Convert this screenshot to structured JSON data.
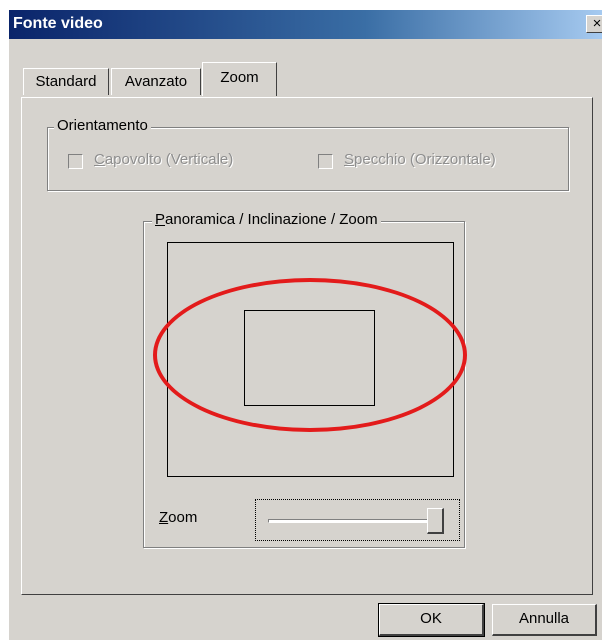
{
  "window": {
    "title": "Fonte video",
    "close_label": "×"
  },
  "tabs": [
    {
      "label": "Standard",
      "active": false
    },
    {
      "label": "Avanzato",
      "active": false
    },
    {
      "label": "Zoom",
      "active": true
    }
  ],
  "orientation": {
    "group_label": "Orientamento",
    "flip_vertical": {
      "label": "Capovolto (Verticale)",
      "checked": false,
      "enabled": false
    },
    "mirror_horizontal": {
      "label": "Specchio (Orizzontale)",
      "checked": false,
      "enabled": false
    }
  },
  "ptz": {
    "group_label": "Panoramica / Inclinazione / Zoom",
    "zoom_label": "Zoom",
    "zoom_level": 1.0
  },
  "buttons": {
    "ok": "OK",
    "cancel": "Annulla"
  },
  "colors": {
    "annotation": "#e31b1b",
    "title_bar": "#0a246a",
    "dialog_bg": "#d6d3ce"
  }
}
